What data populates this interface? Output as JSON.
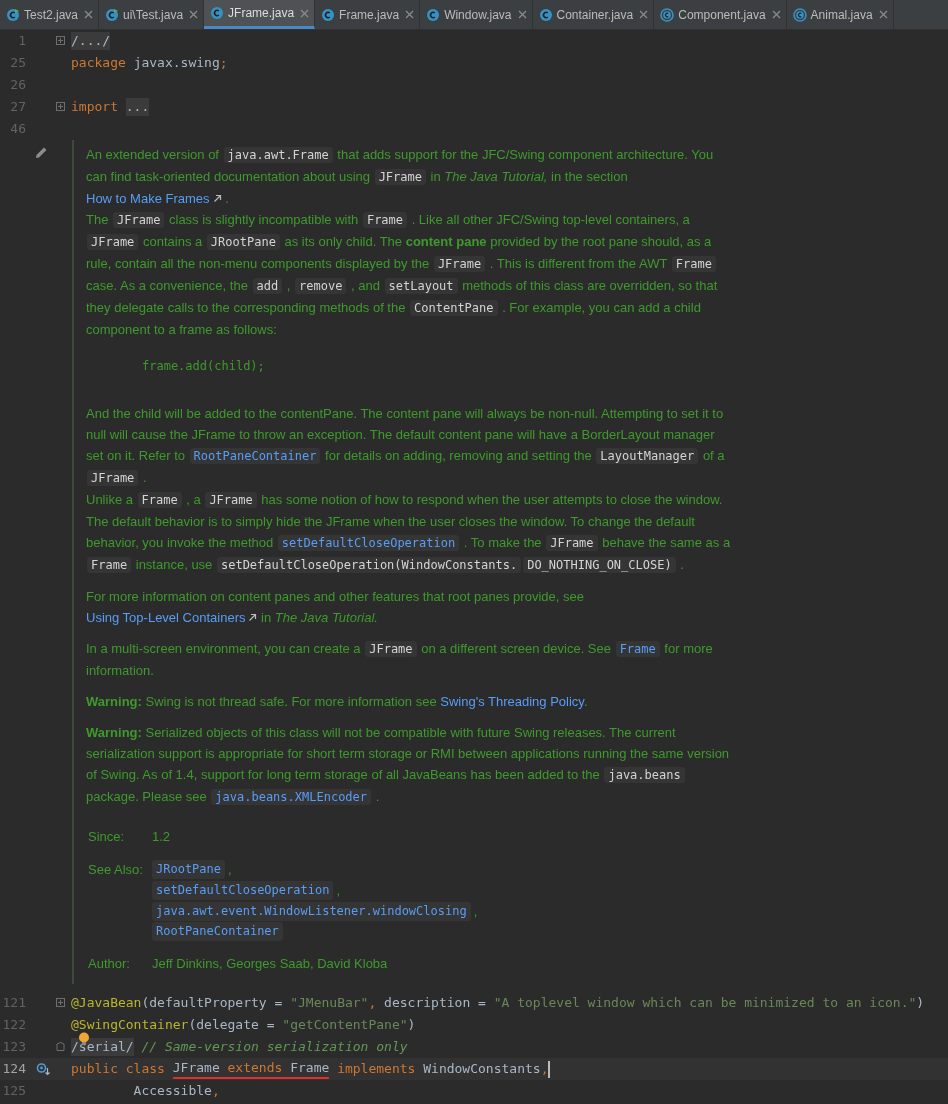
{
  "tabs": [
    {
      "label": "Test2.java",
      "kind": "run",
      "selected": false
    },
    {
      "label": "ui\\Test.java",
      "kind": "run",
      "selected": false
    },
    {
      "label": "JFrame.java",
      "kind": "class",
      "selected": true
    },
    {
      "label": "Frame.java",
      "kind": "class",
      "selected": false
    },
    {
      "label": "Window.java",
      "kind": "class",
      "selected": false
    },
    {
      "label": "Container.java",
      "kind": "class",
      "selected": false
    },
    {
      "label": "Component.java",
      "kind": "abstract",
      "selected": false
    },
    {
      "label": "Animal.java",
      "kind": "abstract",
      "selected": false
    }
  ],
  "code_top": [
    {
      "number": "1",
      "kind": "fold-start",
      "tokens": [
        {
          "kind": "folded",
          "text": "/.../"
        }
      ]
    },
    {
      "number": "25",
      "tokens": [
        {
          "kind": "kw",
          "text": "package "
        },
        {
          "kind": "plain",
          "text": "javax.swing"
        },
        {
          "kind": "kw",
          "text": ";"
        }
      ]
    },
    {
      "number": "26"
    },
    {
      "number": "27",
      "kind": "fold-start",
      "tokens": [
        {
          "kind": "kw",
          "text": "import "
        },
        {
          "kind": "folded",
          "text": "..."
        }
      ]
    },
    {
      "number": "46"
    }
  ],
  "doc": {
    "blocks": [
      {
        "kind": "text",
        "paragraphs": [
          [
            {
              "kind": "t",
              "text": "An extended version of "
            },
            {
              "kind": "code",
              "text": "java.awt.Frame"
            },
            {
              "kind": "t",
              "text": " that adds support for the JFC/Swing component architecture. You can find task-oriented documentation about using "
            },
            {
              "kind": "code",
              "text": "JFrame"
            },
            {
              "kind": "t",
              "text": " in "
            },
            {
              "kind": "i",
              "text": "The Java Tutorial,"
            },
            {
              "kind": "t",
              "text": " in the section "
            },
            {
              "kind": "link",
              "text": "How to Make Frames",
              "external": true
            },
            {
              "kind": "t",
              "text": " ."
            }
          ],
          [
            {
              "kind": "t",
              "text": "The "
            },
            {
              "kind": "code",
              "text": "JFrame"
            },
            {
              "kind": "t",
              "text": " class is slightly incompatible with "
            },
            {
              "kind": "code",
              "text": "Frame"
            },
            {
              "kind": "t",
              "text": " . Like all other JFC/Swing top-level containers, a "
            },
            {
              "kind": "code",
              "text": "JFrame"
            },
            {
              "kind": "t",
              "text": " contains a "
            },
            {
              "kind": "code",
              "text": "JRootPane"
            },
            {
              "kind": "t",
              "text": " as its only child. The "
            },
            {
              "kind": "b",
              "text": "content pane"
            },
            {
              "kind": "t",
              "text": " provided by the root pane should, as a rule, contain all the non-menu components displayed by the "
            },
            {
              "kind": "code",
              "text": "JFrame"
            },
            {
              "kind": "t",
              "text": " . This is different from the AWT "
            },
            {
              "kind": "code",
              "text": "Frame"
            },
            {
              "kind": "t",
              "text": " case. As a convenience, the "
            },
            {
              "kind": "code",
              "text": "add"
            },
            {
              "kind": "t",
              "text": " , "
            },
            {
              "kind": "code",
              "text": "remove"
            },
            {
              "kind": "t",
              "text": " , and "
            },
            {
              "kind": "code",
              "text": "setLayout"
            },
            {
              "kind": "t",
              "text": " methods of this class are overridden, so that they delegate calls to the corresponding methods of the "
            },
            {
              "kind": "code",
              "text": "ContentPane"
            },
            {
              "kind": "t",
              "text": " . For example, you can add a child component to a frame as follows:"
            }
          ]
        ]
      },
      {
        "kind": "pre",
        "text": "frame.add(child);"
      },
      {
        "kind": "text",
        "paragraphs": [
          [
            {
              "kind": "t",
              "text": "And the child will be added to the contentPane. The content pane will always be non-null. Attempting to set it to null will cause the JFrame to throw an exception. The default content pane will have a BorderLayout manager set on it. Refer to "
            },
            {
              "kind": "clink",
              "text": "RootPaneContainer"
            },
            {
              "kind": "t",
              "text": " for details on adding, removing and setting the "
            },
            {
              "kind": "code",
              "text": "LayoutManager"
            },
            {
              "kind": "t",
              "text": " of a "
            },
            {
              "kind": "code",
              "text": "JFrame"
            },
            {
              "kind": "t",
              "text": " ."
            }
          ],
          [
            {
              "kind": "t",
              "text": "Unlike a "
            },
            {
              "kind": "code",
              "text": "Frame"
            },
            {
              "kind": "t",
              "text": " , a "
            },
            {
              "kind": "code",
              "text": "JFrame"
            },
            {
              "kind": "t",
              "text": " has some notion of how to respond when the user attempts to close the window. The default behavior is to simply hide the JFrame when the user closes the window. To change the default behavior, you invoke the method "
            },
            {
              "kind": "clink",
              "text": "setDefaultCloseOperation"
            },
            {
              "kind": "t",
              "text": " . To make the "
            },
            {
              "kind": "code",
              "text": "JFrame"
            },
            {
              "kind": "t",
              "text": " behave the same as a "
            },
            {
              "kind": "code",
              "text": "Frame"
            },
            {
              "kind": "t",
              "text": " instance, use "
            },
            {
              "kind": "code",
              "text": "setDefaultCloseOperation(WindowConstants."
            },
            {
              "kind": "code",
              "text": "DO_NOTHING_ON_CLOSE)"
            },
            {
              "kind": "t",
              "text": " ."
            }
          ]
        ]
      },
      {
        "kind": "text",
        "paragraphs": [
          [
            {
              "kind": "t",
              "text": "For more information on content panes and other features that root panes provide, see "
            },
            {
              "kind": "link",
              "text": "Using Top-Level Containers",
              "external": true
            },
            {
              "kind": "t",
              "text": " in "
            },
            {
              "kind": "i",
              "text": "The Java Tutorial."
            }
          ]
        ]
      },
      {
        "kind": "text",
        "paragraphs": [
          [
            {
              "kind": "t",
              "text": "In a multi-screen environment, you can create a "
            },
            {
              "kind": "code",
              "text": "JFrame"
            },
            {
              "kind": "t",
              "text": " on a different screen device. See "
            },
            {
              "kind": "clink",
              "text": "Frame"
            },
            {
              "kind": "t",
              "text": " for more information."
            }
          ]
        ]
      },
      {
        "kind": "text",
        "paragraphs": [
          [
            {
              "kind": "b",
              "text": "Warning:"
            },
            {
              "kind": "t",
              "text": " Swing is not thread safe. For more information see "
            },
            {
              "kind": "link",
              "text": "Swing's Threading Policy",
              "external": false
            },
            {
              "kind": "t",
              "text": "."
            }
          ]
        ]
      },
      {
        "kind": "text",
        "paragraphs": [
          [
            {
              "kind": "b",
              "text": "Warning:"
            },
            {
              "kind": "t",
              "text": " Serialized objects of this class will not be compatible with future Swing releases. The current serialization support is appropriate for short term storage or RMI between applications running the same version of Swing. As of 1.4, support for long term storage of all JavaBeans has been added to the "
            },
            {
              "kind": "code",
              "text": "java.beans"
            },
            {
              "kind": "t",
              "text": " package. Please see "
            },
            {
              "kind": "clink",
              "text": "java.beans.XMLEncoder"
            },
            {
              "kind": "t",
              "text": " ."
            }
          ]
        ]
      }
    ],
    "tags": [
      {
        "label": "Since:",
        "kind": "text",
        "text": "1.2"
      },
      {
        "label": "See Also:",
        "kind": "links",
        "links": [
          "JRootPane",
          "setDefaultCloseOperation",
          "java.awt.event.WindowListener.windowClosing",
          "RootPaneContainer"
        ],
        "separator": ","
      },
      {
        "label": "Author:",
        "kind": "text",
        "text": "Jeff Dinkins, Georges Saab, David Kloba"
      }
    ]
  },
  "code_bottom": [
    {
      "number": "121",
      "kind": "fold-start",
      "tokens": [
        {
          "kind": "ann",
          "text": "@JavaBean"
        },
        {
          "kind": "plain",
          "text": "(defaultProperty = "
        },
        {
          "kind": "str",
          "text": "\"JMenuBar\""
        },
        {
          "kind": "kw",
          "text": ", "
        },
        {
          "kind": "plain",
          "text": "description = "
        },
        {
          "kind": "str",
          "text": "\"A toplevel window which can be minimized to an icon.\""
        },
        {
          "kind": "plain",
          "text": ")"
        }
      ]
    },
    {
      "number": "122",
      "tokens": [
        {
          "kind": "ann",
          "text": "@SwingContainer"
        },
        {
          "kind": "plain",
          "text": "(delegate = "
        },
        {
          "kind": "str",
          "text": "\"getContentPane\""
        },
        {
          "kind": "plain",
          "text": ")"
        }
      ]
    },
    {
      "number": "123",
      "kind": "fold-end",
      "bulb": true,
      "tokens": [
        {
          "kind": "folded",
          "text": "/serial/"
        },
        {
          "kind": "comment",
          "text": " // Same-version serialization only"
        }
      ]
    },
    {
      "number": "124",
      "current": true,
      "kind": "implements",
      "tokens": [
        {
          "kind": "kw",
          "text": "public class "
        },
        {
          "kind": "plain",
          "text": "JFrame",
          "underlined": true
        },
        {
          "kind": "kw",
          "text": " extends ",
          "underlined": true
        },
        {
          "kind": "plain",
          "text": "Frame",
          "underlined": true
        },
        {
          "kind": "kw",
          "text": " implements "
        },
        {
          "kind": "plain",
          "text": "WindowConstants"
        },
        {
          "kind": "kw",
          "text": ","
        }
      ]
    },
    {
      "number": "125",
      "tokens": [
        {
          "kind": "plain",
          "text": "        Accessible"
        },
        {
          "kind": "kw",
          "text": ","
        }
      ]
    }
  ]
}
